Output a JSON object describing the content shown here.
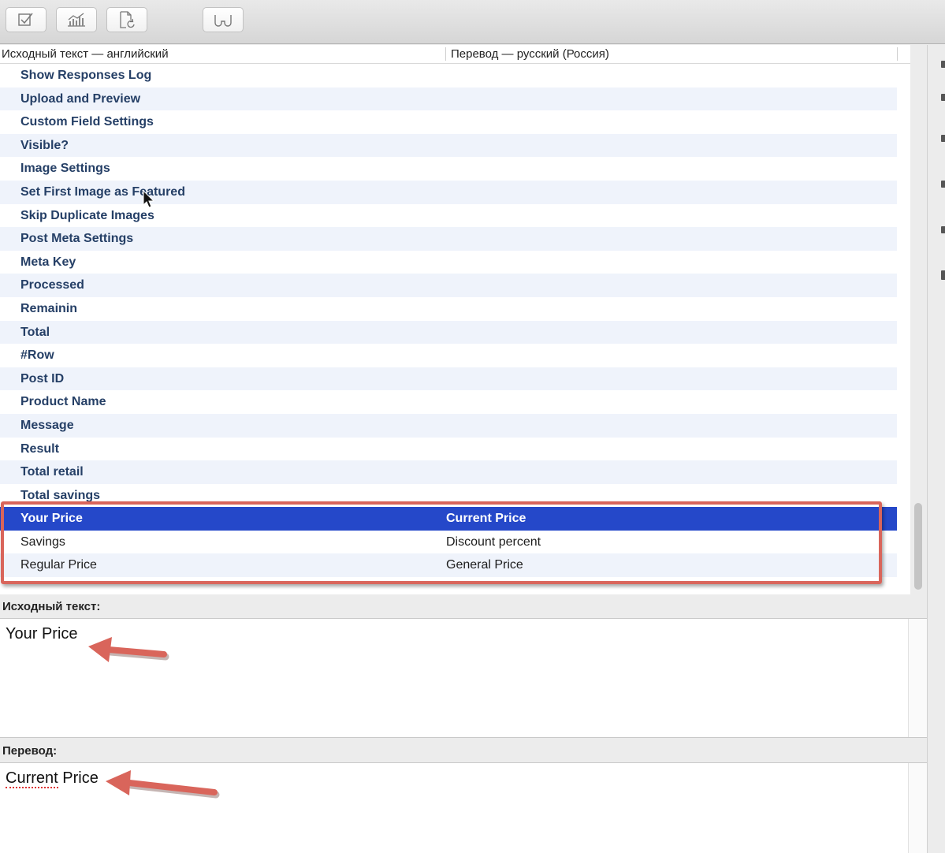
{
  "toolbar": {
    "buttons": [
      {
        "icon": "checkbox-icon"
      },
      {
        "icon": "chart-icon"
      },
      {
        "icon": "refresh-document-icon"
      },
      {
        "icon": "glasses-icon"
      }
    ]
  },
  "list": {
    "column_source": "Исходный текст — английский",
    "column_translation": "Перевод — русский (Россия)",
    "rows": [
      {
        "source": "Show Responses Log",
        "translation": ""
      },
      {
        "source": "Upload and Preview",
        "translation": ""
      },
      {
        "source": "Custom Field Settings",
        "translation": ""
      },
      {
        "source": "Visible?",
        "translation": ""
      },
      {
        "source": "Image Settings",
        "translation": ""
      },
      {
        "source": "Set First Image as Featured",
        "translation": ""
      },
      {
        "source": "Skip Duplicate Images",
        "translation": ""
      },
      {
        "source": "Post Meta Settings",
        "translation": ""
      },
      {
        "source": "Meta Key",
        "translation": ""
      },
      {
        "source": "Processed",
        "translation": ""
      },
      {
        "source": "Remainin",
        "translation": ""
      },
      {
        "source": "Total",
        "translation": ""
      },
      {
        "source": "#Row",
        "translation": ""
      },
      {
        "source": "Post ID",
        "translation": ""
      },
      {
        "source": "Product Name",
        "translation": ""
      },
      {
        "source": "Message",
        "translation": ""
      },
      {
        "source": "Result",
        "translation": ""
      },
      {
        "source": "Total retail",
        "translation": ""
      },
      {
        "source": "Total savings",
        "translation": ""
      },
      {
        "source": "Your Price",
        "translation": "Current Price"
      },
      {
        "source": "Savings",
        "translation": "Discount percent"
      },
      {
        "source": "Regular Price",
        "translation": "General Price"
      }
    ],
    "selected_index": 19
  },
  "source_editor": {
    "label": "Исходный текст:",
    "text": "Your Price"
  },
  "translation_editor": {
    "label": "Перевод:",
    "text_misspelled": "Current",
    "text_rest": " Price"
  },
  "colors": {
    "selection": "#2548c9",
    "annotation": "#d9655b",
    "untranslated_text": "#253f66",
    "row_alt": "#eff3fb"
  }
}
